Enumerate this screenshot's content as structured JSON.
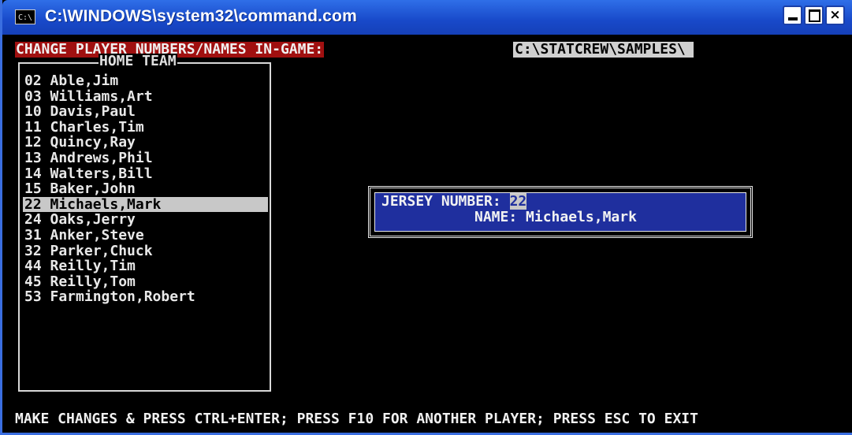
{
  "window": {
    "title": "C:\\WINDOWS\\system32\\command.com",
    "icon_label": "C:\\",
    "controls": {
      "minimize": "minimize",
      "maximize": "maximize",
      "close": "×"
    }
  },
  "header": {
    "left": "CHANGE PLAYER NUMBERS/NAMES IN-GAME:",
    "right": "C:\\STATCREW\\SAMPLES\\"
  },
  "team": {
    "title": "HOME TEAM",
    "players": [
      "02 Able,Jim",
      "03 Williams,Art",
      "10 Davis,Paul",
      "11 Charles,Tim",
      "12 Quincy,Ray",
      "13 Andrews,Phil",
      "14 Walters,Bill",
      "15 Baker,John",
      "22 Michaels,Mark",
      "24 Oaks,Jerry",
      "31 Anker,Steve",
      "32 Parker,Chuck",
      "44 Reilly,Tim",
      "45 Reilly,Tom",
      "53 Farmington,Robert"
    ],
    "selected_index": 8
  },
  "dialog": {
    "jersey_label": "JERSEY NUMBER:",
    "jersey_value": "22",
    "name_label": "NAME:",
    "name_value": "Michaels,Mark"
  },
  "status": "MAKE CHANGES & PRESS CTRL+ENTER; PRESS F10 FOR ANOTHER PLAYER; PRESS ESC TO EXIT",
  "colors": {
    "titlebar": "#1849c9",
    "header_left_bg": "#a01010",
    "header_right_bg": "#d0d0d0",
    "dialog_bg": "#1f2f9e",
    "selection_bg": "#c8c8c8"
  }
}
